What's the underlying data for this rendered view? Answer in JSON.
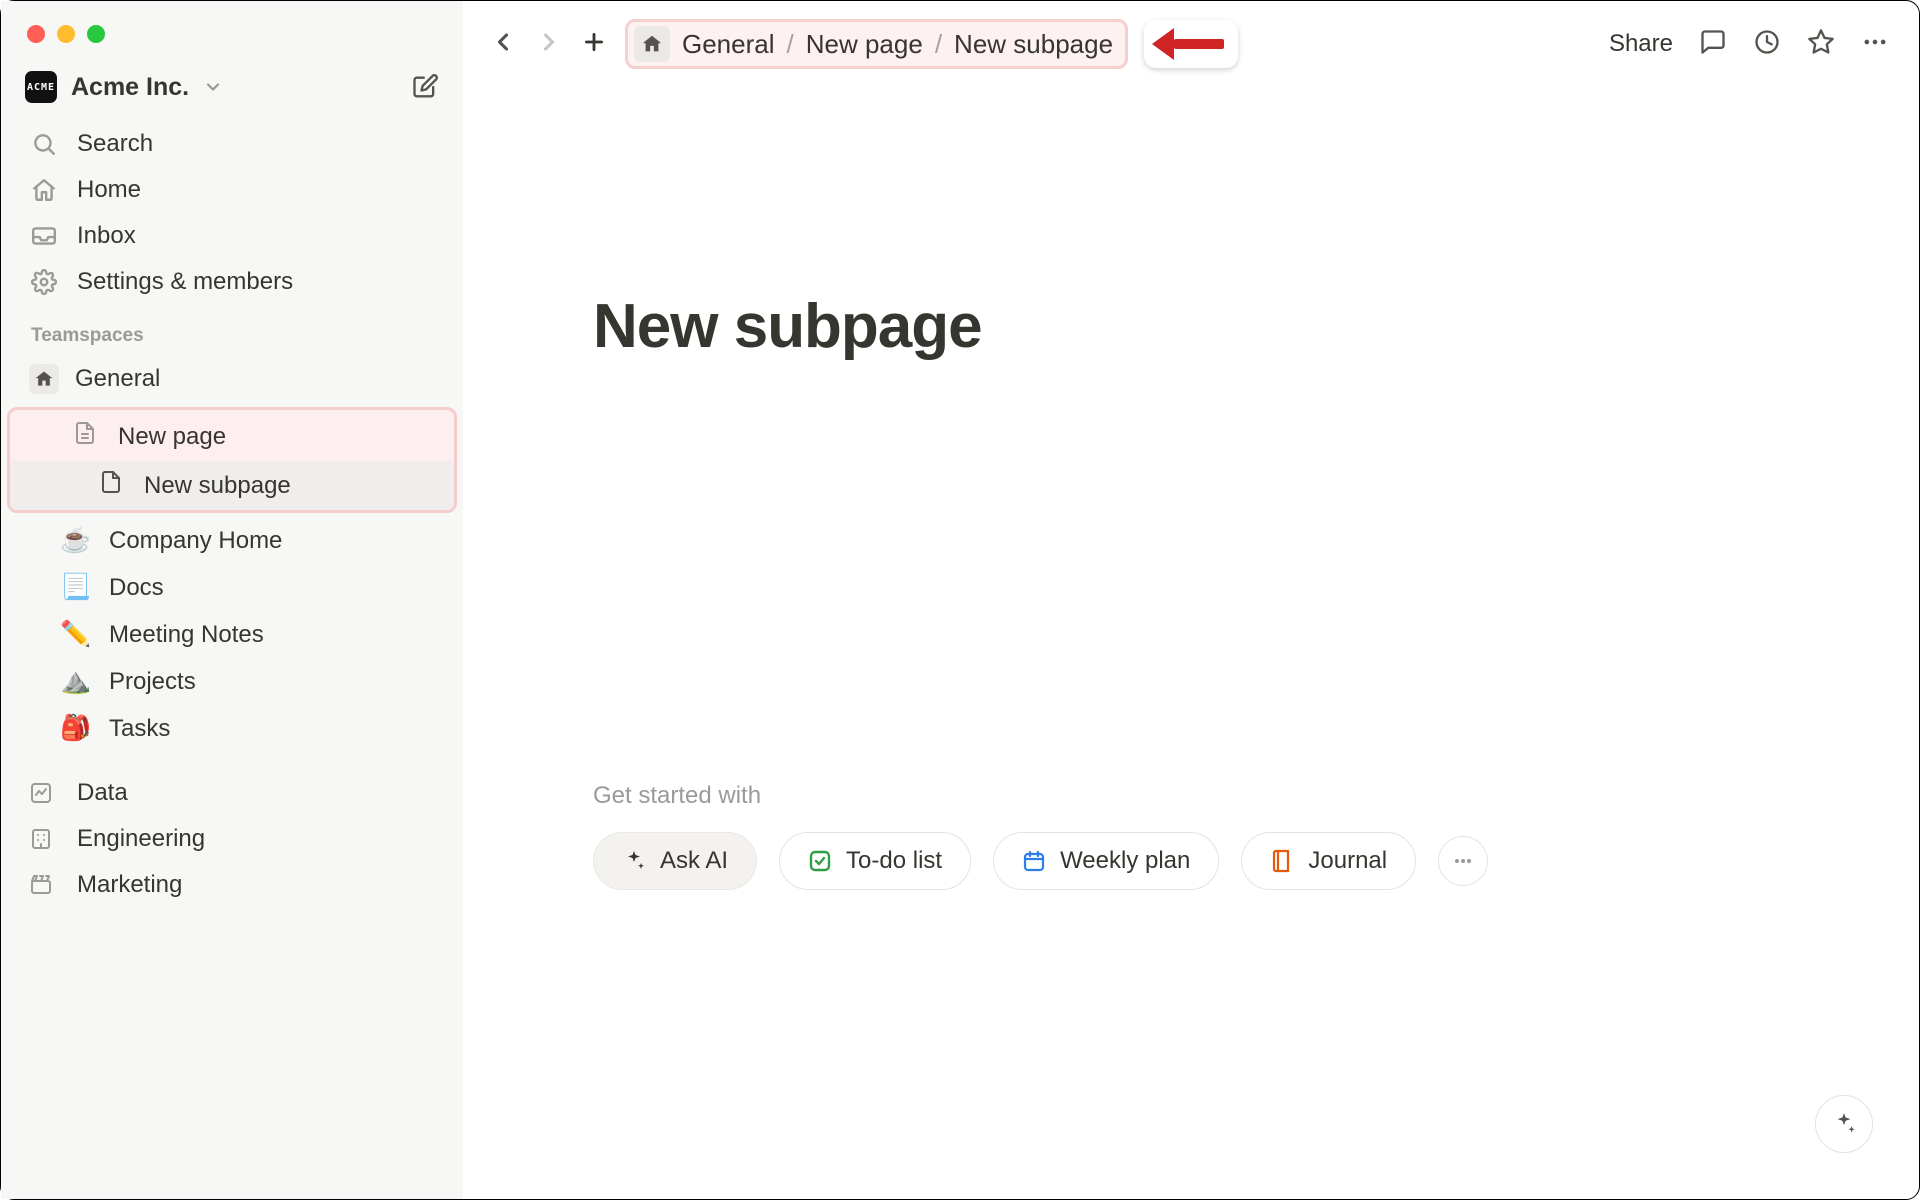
{
  "workspace": {
    "name": "Acme Inc.",
    "badge": "ACME"
  },
  "sidebar": {
    "search": "Search",
    "home": "Home",
    "inbox": "Inbox",
    "settings": "Settings & members",
    "section": "Teamspaces",
    "general": "General",
    "new_page": "New page",
    "new_subpage": "New subpage",
    "company_home": "Company Home",
    "docs": "Docs",
    "meeting_notes": "Meeting Notes",
    "projects": "Projects",
    "tasks": "Tasks",
    "emoji": {
      "company_home": "☕",
      "docs": "📃",
      "meeting_notes": "✏️",
      "projects": "⛰️",
      "tasks": "🎒"
    },
    "db": {
      "data": "Data",
      "engineering": "Engineering",
      "marketing": "Marketing"
    }
  },
  "topbar": {
    "share": "Share",
    "crumb1": "General",
    "crumb2": "New page",
    "crumb3": "New subpage",
    "sep": "/"
  },
  "page": {
    "title": "New subpage"
  },
  "starter": {
    "label": "Get started with",
    "ask_ai": "Ask AI",
    "todo": "To-do list",
    "weekly": "Weekly plan",
    "journal": "Journal"
  }
}
